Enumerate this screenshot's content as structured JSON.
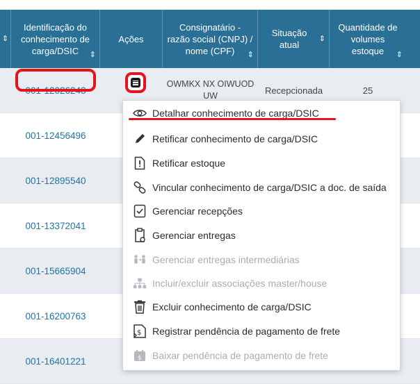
{
  "table": {
    "headers": [
      {
        "label": "Identificação do conhecimento de carga/DSIC"
      },
      {
        "label": "Ações"
      },
      {
        "label": "Consignatário - razão social (CNPJ) / nome (CPF)"
      },
      {
        "label": "Situação atual"
      },
      {
        "label": "Quantidade de volumes estoque"
      }
    ],
    "rows": [
      {
        "id": "001-12026243",
        "consignee": "OWMKX NX OIWUOD UW",
        "status": "Recepcionada",
        "quantity": "25"
      },
      {
        "id": "001-12456496"
      },
      {
        "id": "001-12895540"
      },
      {
        "id": "001-13372041"
      },
      {
        "id": "001-15665904"
      },
      {
        "id": "001-16200763"
      },
      {
        "id": "001-16401221"
      }
    ]
  },
  "menu": {
    "items": [
      {
        "label": "Detalhar conhecimento de carga/DSIC",
        "icon": "eye-icon",
        "enabled": true
      },
      {
        "label": "Retificar conhecimento de carga/DSIC",
        "icon": "pencil-icon",
        "enabled": true
      },
      {
        "label": "Retificar estoque",
        "icon": "exclamation-document-icon",
        "enabled": true
      },
      {
        "label": "Vincular conhecimento de carga/DSIC a doc. de saída",
        "icon": "link-icon",
        "enabled": true
      },
      {
        "label": "Gerenciar recepções",
        "icon": "checklist-icon",
        "enabled": true
      },
      {
        "label": "Gerenciar entregas",
        "icon": "clipboard-icon",
        "enabled": true
      },
      {
        "label": "Gerenciar entregas intermediárias",
        "icon": "people-transfer-icon",
        "enabled": false
      },
      {
        "label": "Incluir/excluir associações master/house",
        "icon": "hierarchy-icon",
        "enabled": false
      },
      {
        "label": "Excluir conhecimento de carga/DSIC",
        "icon": "trash-icon",
        "enabled": true
      },
      {
        "label": "Registrar pendência de pagamento de frete",
        "icon": "money-document-icon",
        "enabled": true
      },
      {
        "label": "Baixar pendência de pagamento de frete",
        "icon": "money-calendar-icon",
        "enabled": false
      }
    ]
  },
  "colors": {
    "header_bg": "#2a6f95",
    "link": "#1f74a8",
    "highlight": "#e3141b",
    "row_alt": "#e9ecf0"
  }
}
